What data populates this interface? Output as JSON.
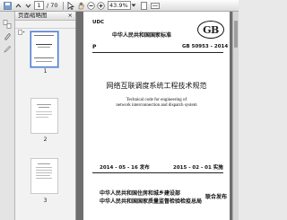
{
  "toolbar": {
    "current_page": "1",
    "total_pages": "/ 70",
    "zoom": "43.9%"
  },
  "thumbnails": {
    "title": "页面缩略图",
    "close": "×",
    "pages": [
      "1",
      "2",
      "3"
    ]
  },
  "document": {
    "udc": "UDC",
    "p_label": "P",
    "standard_title": "中华人民共和国国家标准",
    "standard_number": "GB 50953 - 2014",
    "logo_text": "GB",
    "cn_title": "网络互联调度系统工程技术规范",
    "en_title_1": "Technical code for engineering of",
    "en_title_2": "network interconnection and dispatch system",
    "issue_date": "2014 - 05 - 16  发布",
    "impl_date": "2015 - 02 - 01  实施",
    "publisher_1": "中华人民共和国住房和城乡建设部",
    "publisher_2": "中华人民共和国国家质量监督检验检疫总局",
    "joint_issue": "联合发布"
  }
}
